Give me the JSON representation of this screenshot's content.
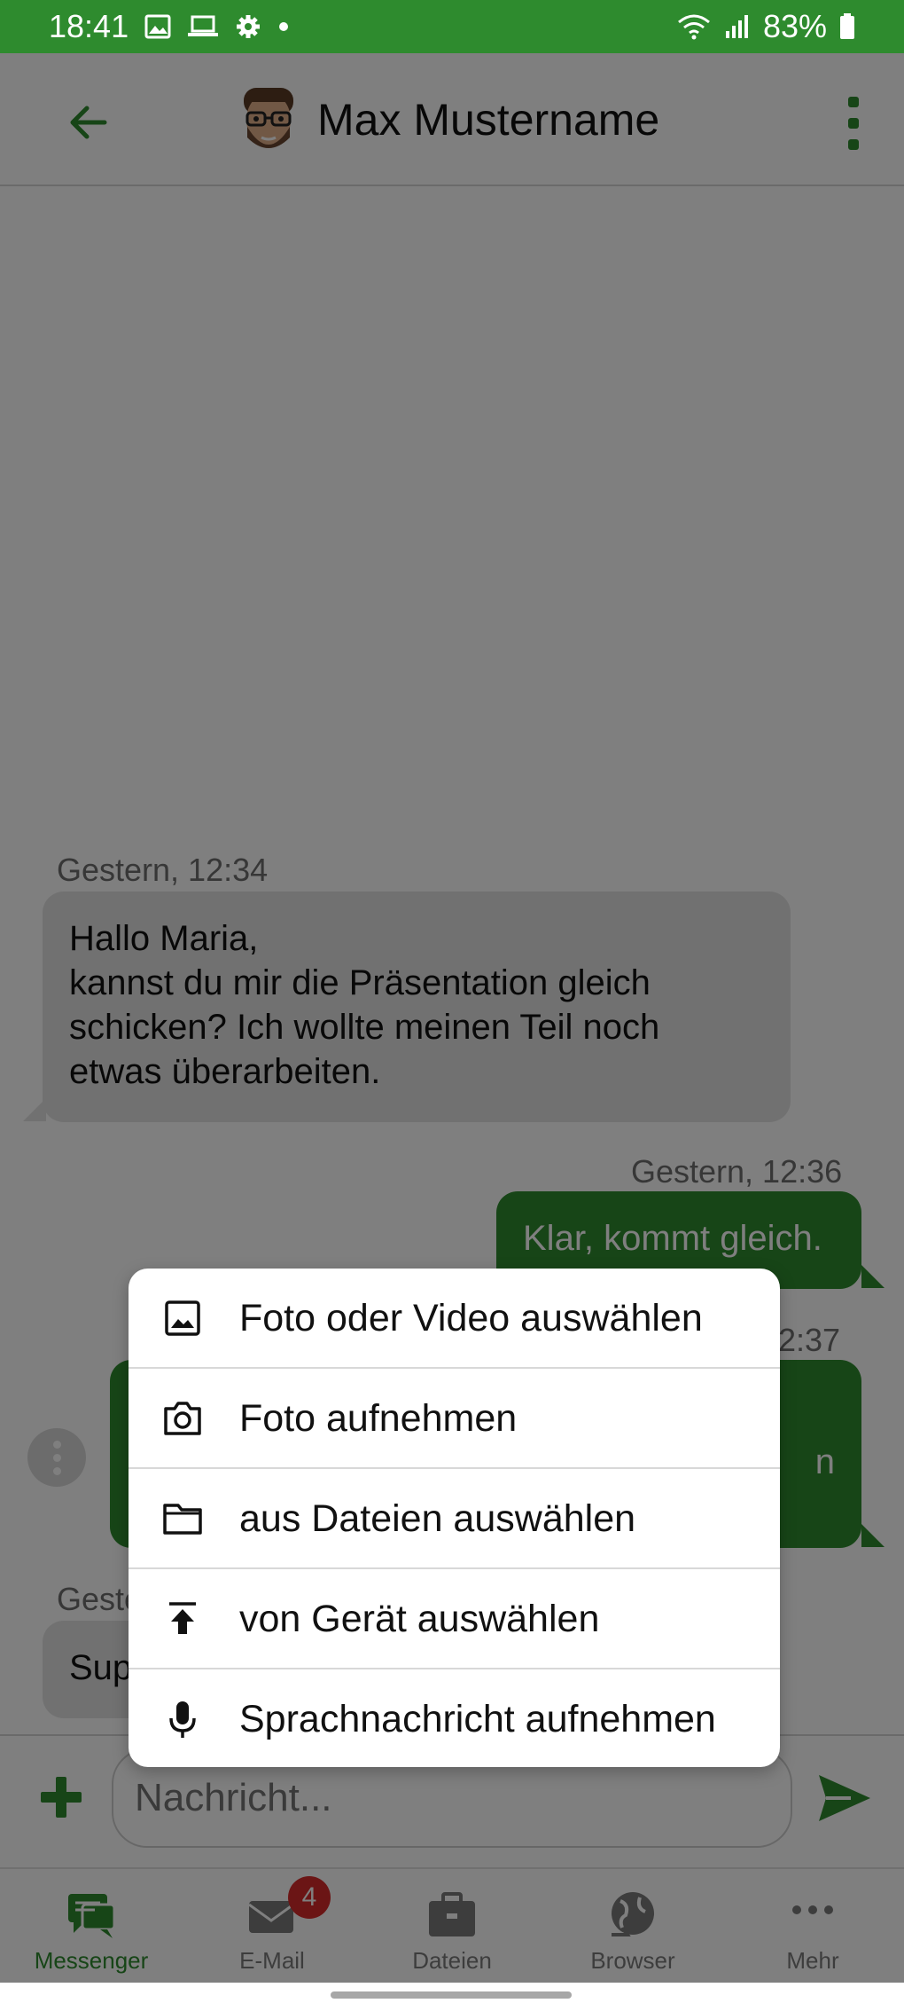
{
  "status_bar": {
    "time": "18:41",
    "battery": "83%"
  },
  "header": {
    "contact_name": "Max Mustername"
  },
  "messages": [
    {
      "direction": "in",
      "timestamp": "Gestern, 12:34",
      "text": "Hallo Maria,\nkannst du mir die Präsentation gleich\nschicken? Ich wollte meinen Teil noch\netwas überarbeiten."
    },
    {
      "direction": "out",
      "timestamp": "Gestern, 12:36",
      "text": "Klar, kommt gleich."
    },
    {
      "direction": "out",
      "timestamp_visible": "2:37",
      "text_visible": "n"
    },
    {
      "direction": "in",
      "timestamp_visible": "Geste",
      "text_visible": "Sup"
    }
  ],
  "composer": {
    "placeholder": "Nachricht..."
  },
  "attach_menu": {
    "items": [
      {
        "label": "Foto oder Video auswählen",
        "icon": "image-icon"
      },
      {
        "label": "Foto aufnehmen",
        "icon": "camera-icon"
      },
      {
        "label": "aus Dateien auswählen",
        "icon": "folder-icon"
      },
      {
        "label": "von Gerät auswählen",
        "icon": "upload-icon"
      },
      {
        "label": "Sprachnachricht aufnehmen",
        "icon": "microphone-icon"
      }
    ]
  },
  "bottom_nav": {
    "items": [
      {
        "label": "Messenger",
        "icon": "messenger-icon",
        "active": true
      },
      {
        "label": "E-Mail",
        "icon": "mail-icon",
        "badge": "4"
      },
      {
        "label": "Dateien",
        "icon": "briefcase-icon"
      },
      {
        "label": "Browser",
        "icon": "globe-icon"
      },
      {
        "label": "Mehr",
        "icon": "more-dots-icon"
      }
    ]
  },
  "colors": {
    "accent": "#2e8b2e",
    "badge": "#d72a2a"
  }
}
